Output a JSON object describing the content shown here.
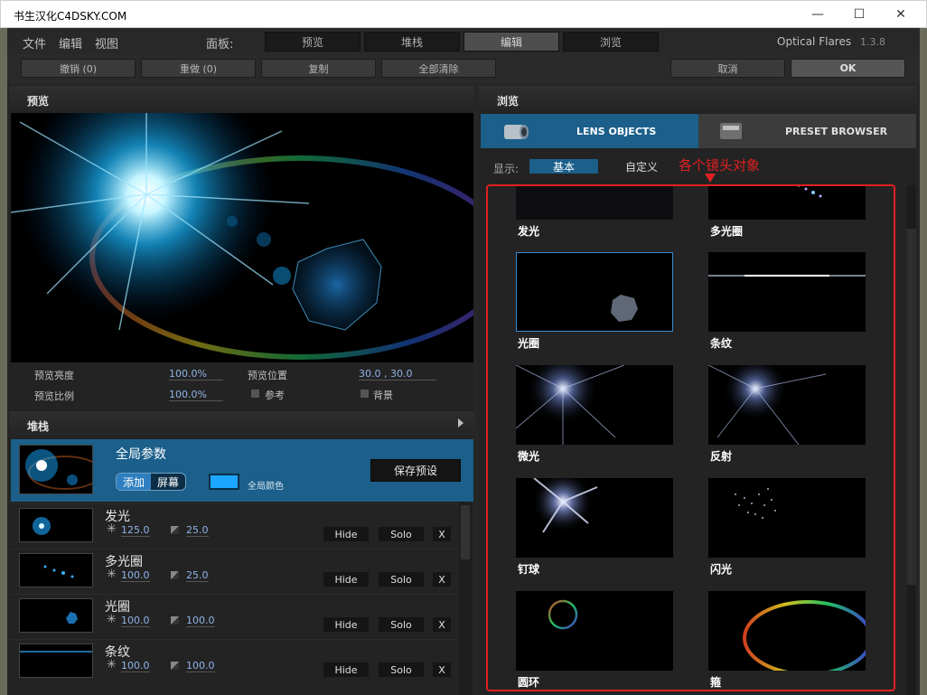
{
  "window": {
    "title": "书生汉化C4DSKY.COM",
    "min": "—",
    "max": "☐",
    "close": "✕"
  },
  "menu": {
    "items": [
      "文件",
      "编辑",
      "视图"
    ],
    "panel_label": "面板:",
    "panel_tabs": [
      "预览",
      "堆栈",
      "编辑",
      "浏览"
    ],
    "active_tab": "编辑",
    "brand": "Optical Flares",
    "version": "1.3.8"
  },
  "toolbar": {
    "undo": "撤销 (0)",
    "redo": "重做 (0)",
    "copy": "复制",
    "clear_all": "全部清除",
    "cancel": "取消",
    "ok": "OK"
  },
  "preview": {
    "header": "预览",
    "brightness_label": "预览亮度",
    "brightness_value": "100.0%",
    "scale_label": "预览比例",
    "scale_value": "100.0%",
    "position_label": "预览位置",
    "position_value": "30.0 , 30.0",
    "reference_label": "参考",
    "background_label": "背景"
  },
  "stack": {
    "header": "堆栈",
    "global_title": "全局参数",
    "toggle_add": "添加",
    "toggle_screen": "屏幕",
    "global_color_label": "全局颜色",
    "global_color": "#1ca6ff",
    "save_preset": "保存预设",
    "layers": [
      {
        "name": "发光",
        "brightness": "125.0",
        "scale": "25.0",
        "hide": "Hide",
        "solo": "Solo",
        "remove": "X"
      },
      {
        "name": "多光圈",
        "brightness": "100.0",
        "scale": "25.0",
        "hide": "Hide",
        "solo": "Solo",
        "remove": "X"
      },
      {
        "name": "光圈",
        "brightness": "100.0",
        "scale": "100.0",
        "hide": "Hide",
        "solo": "Solo",
        "remove": "X"
      },
      {
        "name": "条纹",
        "brightness": "100.0",
        "scale": "100.0",
        "hide": "Hide",
        "solo": "Solo",
        "remove": "X"
      }
    ]
  },
  "browser": {
    "header": "浏览",
    "tab_lens": "LENS OBJECTS",
    "tab_preset": "PRESET BROWSER",
    "show_label": "显示:",
    "show_basic": "基本",
    "show_custom": "自定义",
    "annotation": "各个镜头对象",
    "objects": [
      "发光",
      "多光圈",
      "光圈",
      "条纹",
      "微光",
      "反射",
      "钉球",
      "闪光",
      "圆环",
      "箍"
    ]
  }
}
